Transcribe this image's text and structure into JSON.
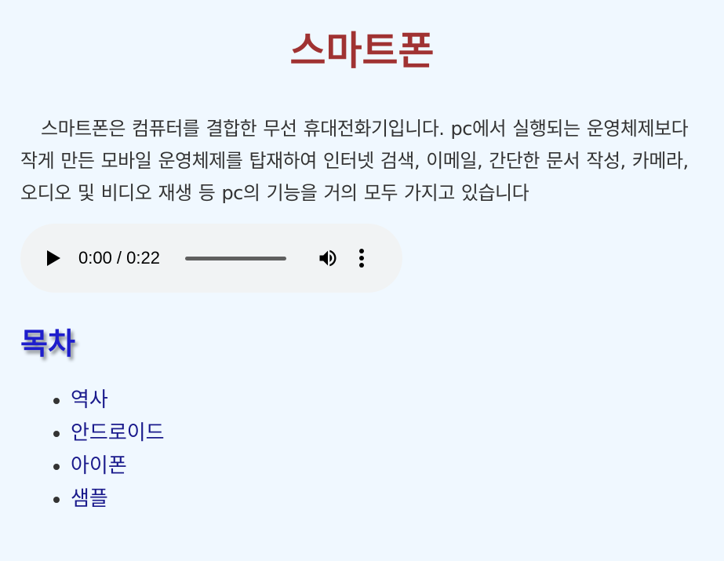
{
  "page": {
    "title": "스마트폰",
    "intro": "스마트폰은 컴퓨터를 결합한 무선 휴대전화기입니다. pc에서 실행되는 운영체제보다 작게 만든 모바일 운영체제를 탑재하여 인터넷 검색, 이메일, 간단한 문서 작성, 카메라, 오디오 및 비디오 재생 등 pc의 기능을 거의 모두 가지고 있습니다"
  },
  "audio_player": {
    "time_display": "0:00 / 0:22",
    "current_time": "0:00",
    "duration": "0:22",
    "progress": 0,
    "icons": {
      "play": "play-icon",
      "volume": "volume-icon",
      "more": "more-options-icon"
    }
  },
  "toc": {
    "heading": "목차",
    "items": [
      {
        "label": "역사"
      },
      {
        "label": "안드로이드"
      },
      {
        "label": "아이폰"
      },
      {
        "label": "샘플"
      }
    ]
  },
  "colors": {
    "background": "#f0f8ff",
    "title": "#a03232",
    "toc_heading": "#1e1ecc",
    "link": "#1a1a8c"
  }
}
